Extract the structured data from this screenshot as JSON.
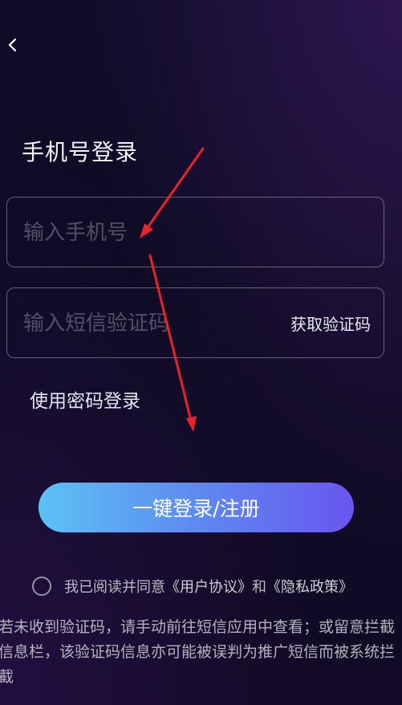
{
  "header": {
    "back_icon": "chevron-left-icon"
  },
  "title": "手机号登录",
  "phone_field": {
    "placeholder": "输入手机号",
    "value": ""
  },
  "code_field": {
    "placeholder": "输入短信验证码",
    "value": "",
    "get_code_label": "获取验证码"
  },
  "password_login_label": "使用密码登录",
  "login_button_label": "一键登录/注册",
  "agreement": {
    "prefix": "我已阅读并同意",
    "user_agreement": "《用户协议》",
    "and": "和",
    "privacy_policy": "《隐私政策》",
    "checked": false
  },
  "note": "若未收到验证码，请手动前往短信应用中查看；或留意拦截信息栏，该验证码信息亦可能被误判为推广短信而被系统拦截",
  "colors": {
    "annotation_arrow": "#e8232b",
    "button_start": "#5cc2f4",
    "button_end": "#6a55f0"
  }
}
